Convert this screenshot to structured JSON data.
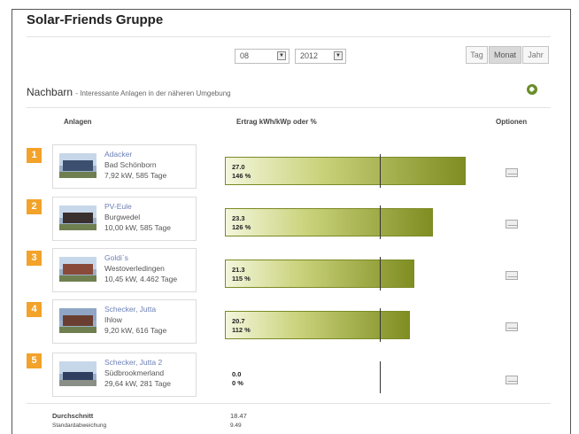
{
  "header": {
    "title": "Solar-Friends Gruppe"
  },
  "filters": {
    "month": "08",
    "year": "2012",
    "periods": [
      "Tag",
      "Monat",
      "Jahr"
    ],
    "active_period": "Monat"
  },
  "section": {
    "title": "Nachbarn",
    "subtitle": "- Interessante Anlagen in der näheren Umgebung"
  },
  "columns": {
    "anlagen": "Anlagen",
    "ertrag": "Ertrag kWh/kWp oder %",
    "optionen": "Optionen"
  },
  "rows": [
    {
      "rank": "1",
      "name": "Adacker",
      "place": "Bad Schönborn",
      "info": "7,92 kW, 585 Tage",
      "value": "27.0",
      "percent": "146 %",
      "percent_value": 146
    },
    {
      "rank": "2",
      "name": "PV-Eule",
      "place": "Burgwedel",
      "info": "10,00 kW, 585 Tage",
      "value": "23.3",
      "percent": "126 %",
      "percent_value": 126
    },
    {
      "rank": "3",
      "name": "Goldi`s",
      "place": "Westoverledingen",
      "info": "10,45 kW, 4.462 Tage",
      "value": "21.3",
      "percent": "115 %",
      "percent_value": 115
    },
    {
      "rank": "4",
      "name": "Schecker, Jutta",
      "place": "Ihlow",
      "info": "9,20 kW, 616 Tage",
      "value": "20.7",
      "percent": "112 %",
      "percent_value": 112
    },
    {
      "rank": "5",
      "name": "Schecker, Jutta 2",
      "place": "Südbrookmerland",
      "info": "29,64 kW, 281 Tage",
      "value": "0.0",
      "percent": "0 %",
      "percent_value": 0
    }
  ],
  "footer": {
    "avg_label": "Durchschnitt",
    "avg_value": "18.47",
    "std_label": "Standardabweichung",
    "std_value": "9.49"
  },
  "icons": {
    "select_arrow": "chevron-down-icon",
    "globe": "globe-icon",
    "options": "mail-icon"
  },
  "colors": {
    "rank_badge": "#f3a22a",
    "bar_start": "#f4f6dc",
    "bar_end": "#7f8d22",
    "link": "#6b7fb5"
  }
}
